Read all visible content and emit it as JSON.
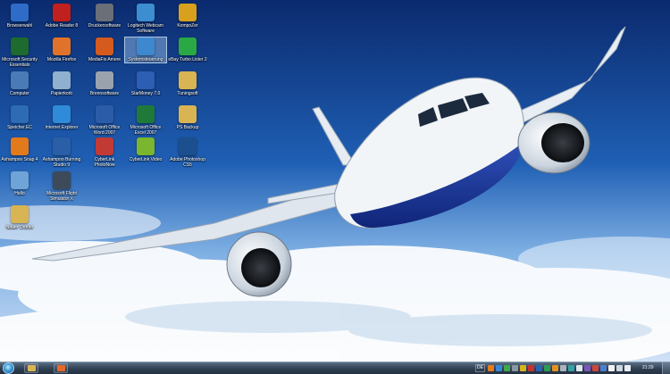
{
  "desktop": {
    "icons": [
      {
        "label": "Browserwahl",
        "icon": "browser-choice-icon",
        "color": "#2f6cc7"
      },
      {
        "label": "Adobe Reader 8",
        "icon": "pdf-icon",
        "color": "#c0201e"
      },
      {
        "label": "Druckersoftware",
        "icon": "printer-icon",
        "color": "#6a6f78"
      },
      {
        "label": "Logitech Webcam Software",
        "icon": "webcam-icon",
        "color": "#3c8ed0"
      },
      {
        "label": "KompoZer",
        "icon": "kompozer-icon",
        "color": "#d8a11d"
      },
      {
        "label": "Microsoft Security Essentials",
        "icon": "shield-icon",
        "color": "#1d6b2e"
      },
      {
        "label": "Mozilla Firefox",
        "icon": "firefox-icon",
        "color": "#e0722a"
      },
      {
        "label": "MediaFix Amere",
        "icon": "disc-icon",
        "color": "#d45a1e"
      },
      {
        "label": "Systemsteuerung",
        "icon": "control-panel-icon",
        "color": "#3e88cf"
      },
      {
        "label": "eBay Turbo Lister 2",
        "icon": "ebay-icon",
        "color": "#2aa845"
      },
      {
        "label": "Computer",
        "icon": "computer-icon",
        "color": "#4a7bb7"
      },
      {
        "label": "Papierkorb",
        "icon": "recycle-bin-icon",
        "color": "#8fb0cf"
      },
      {
        "label": "Brennsoftware",
        "icon": "burner-disc-icon",
        "color": "#9aa3ad"
      },
      {
        "label": "StarMoney 7.0",
        "icon": "starmoney-icon",
        "color": "#2c5fb3"
      },
      {
        "label": "Tuningsoft",
        "icon": "folder-icon",
        "color": "#d9b452"
      },
      {
        "label": "Speicher.EC",
        "icon": "network-icon",
        "color": "#2e6bb5"
      },
      {
        "label": "Internet Explorer",
        "icon": "internet-explorer-icon",
        "color": "#2f8ad8"
      },
      {
        "label": "Microsoft Office Word 2007",
        "icon": "word-icon",
        "color": "#2b5ca8"
      },
      {
        "label": "Microsoft Office Excel 2007",
        "icon": "excel-icon",
        "color": "#1f7a3a"
      },
      {
        "label": "PS Backup",
        "icon": "folder-icon",
        "color": "#d9b452"
      },
      {
        "label": "Ashampoo Snap 4",
        "icon": "ashampoo-icon",
        "color": "#e27a1c"
      },
      {
        "label": "Ashampoo Burning Studio 9",
        "icon": "ashampoo-burning-icon",
        "color": "#2a5fa8"
      },
      {
        "label": "CyberLink PhotoNow",
        "icon": "photo-icon",
        "color": "#c23a36"
      },
      {
        "label": "CyberLink Video",
        "icon": "video-icon",
        "color": "#7ab62e"
      },
      {
        "label": "Adobe Photoshop CS5",
        "icon": "photoshop-icon",
        "color": "#1b4f8e"
      },
      {
        "label": "Hallo",
        "icon": "text-file-icon",
        "color": "#6fa4d8"
      },
      {
        "label": "Microsoft Flight Simulator X",
        "icon": "airplane-icon",
        "color": "#3c4a5a"
      },
      {
        "label": "Neuer Ordner",
        "icon": "folder-icon",
        "color": "#d9b452"
      }
    ],
    "selected_label": "Systemsteuerung"
  },
  "taskbar": {
    "pinned": [
      {
        "name": "taskbar-explorer-button",
        "icon": "folder-icon",
        "color": "#d9b452"
      },
      {
        "name": "taskbar-media-button",
        "icon": "media-player-icon",
        "color": "#e46a2a"
      }
    ],
    "language": "DE",
    "tray_icons": [
      {
        "icon": "tray-orange-icon",
        "color": "#e67a1f"
      },
      {
        "icon": "tray-blue-icon",
        "color": "#3a86d6"
      },
      {
        "icon": "tray-green-icon",
        "color": "#3fa84a"
      },
      {
        "icon": "tray-gray-icon",
        "color": "#8c97a3"
      },
      {
        "icon": "tray-yellow-icon",
        "color": "#d9b21f"
      },
      {
        "icon": "tray-red-icon",
        "color": "#c8322c"
      },
      {
        "icon": "tray-blue2-icon",
        "color": "#2b63b3"
      },
      {
        "icon": "tray-green2-icon",
        "color": "#2f9b56"
      },
      {
        "icon": "tray-orange2-icon",
        "color": "#e6911f"
      },
      {
        "icon": "tray-gray2-icon",
        "color": "#a9b3bd"
      },
      {
        "icon": "tray-teal-icon",
        "color": "#2fa3a6"
      },
      {
        "icon": "tray-white-icon",
        "color": "#dfe6ee"
      },
      {
        "icon": "tray-purple-icon",
        "color": "#7d55b8"
      },
      {
        "icon": "tray-red2-icon",
        "color": "#d2453a"
      },
      {
        "icon": "tray-blue3-icon",
        "color": "#4a7fd0"
      },
      {
        "icon": "tray-flag-icon",
        "color": "#f2f2f2"
      },
      {
        "icon": "tray-network-icon",
        "color": "#cfd7df"
      },
      {
        "icon": "tray-volume-icon",
        "color": "#e9eef3"
      }
    ],
    "clock": "21:29"
  }
}
